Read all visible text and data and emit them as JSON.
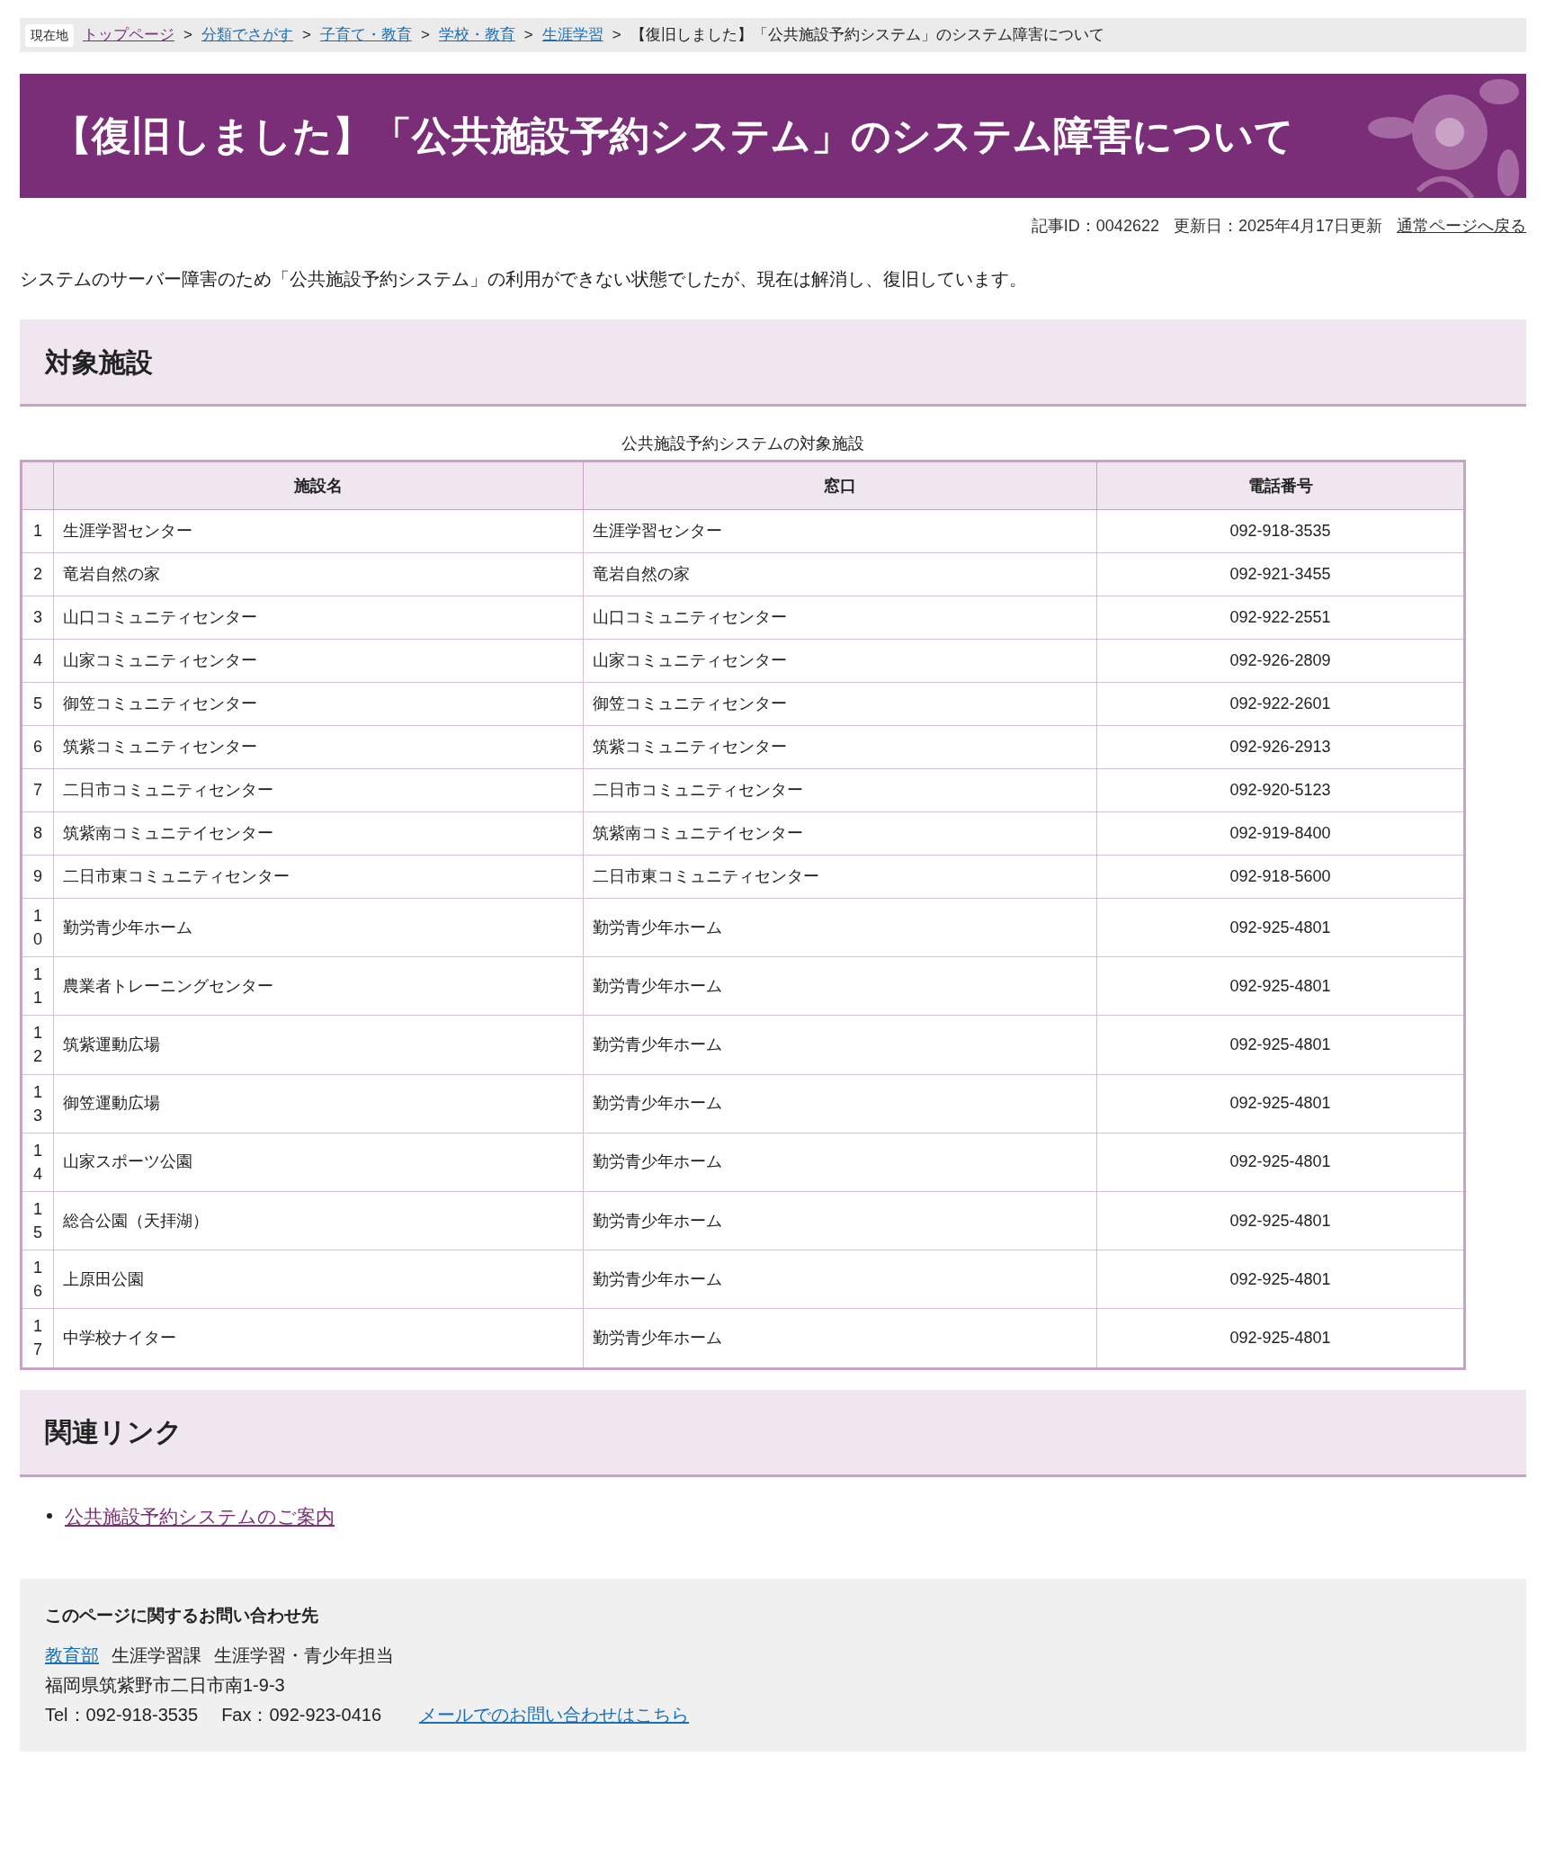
{
  "breadcrumb": {
    "label": "現在地",
    "links": [
      "トップページ",
      "分類でさがす",
      "子育て・教育",
      "学校・教育",
      "生涯学習"
    ],
    "separator": ">",
    "current": "【復旧しました】「公共施設予約システム」のシステム障害について"
  },
  "title": "【復旧しました】「公共施設予約システム」のシステム障害について",
  "meta": {
    "article_id": "記事ID：0042622",
    "updated": "更新日：2025年4月17日更新",
    "back_link": "通常ページへ戻る"
  },
  "intro": "システムのサーバー障害のため「公共施設予約システム」の利用ができない状態でしたが、現在は解消し、復旧しています。",
  "section_facilities": {
    "heading": "対象施設",
    "table": {
      "caption": "公共施設予約システムの対象施設",
      "columns": [
        "施設名",
        "窓口",
        "電話番号"
      ],
      "rows": [
        {
          "no": "1",
          "name": "生涯学習センター",
          "window": "生涯学習センター",
          "phone": "092-918-3535"
        },
        {
          "no": "2",
          "name": "竜岩自然の家",
          "window": "竜岩自然の家",
          "phone": "092-921-3455"
        },
        {
          "no": "3",
          "name": "山口コミュニティセンター",
          "window": "山口コミュニティセンター",
          "phone": "092-922-2551"
        },
        {
          "no": "4",
          "name": "山家コミュニティセンター",
          "window": "山家コミュニティセンター",
          "phone": "092-926-2809"
        },
        {
          "no": "5",
          "name": "御笠コミュニティセンター",
          "window": "御笠コミュニティセンター",
          "phone": "092-922-2601"
        },
        {
          "no": "6",
          "name": "筑紫コミュニティセンター",
          "window": "筑紫コミュニティセンター",
          "phone": "092-926-2913"
        },
        {
          "no": "7",
          "name": "二日市コミュニティセンター",
          "window": "二日市コミュニティセンター",
          "phone": "092-920-5123"
        },
        {
          "no": "8",
          "name": "筑紫南コミュニテイセンター",
          "window": "筑紫南コミュニテイセンター",
          "phone": "092-919-8400"
        },
        {
          "no": "9",
          "name": "二日市東コミュニティセンター",
          "window": "二日市東コミュニティセンター",
          "phone": "092-918-5600"
        },
        {
          "no": "10",
          "name": "勤労青少年ホーム",
          "window": "勤労青少年ホーム",
          "phone": "092-925-4801"
        },
        {
          "no": "11",
          "name": "農業者トレーニングセンター",
          "window": "勤労青少年ホーム",
          "phone": "092-925-4801"
        },
        {
          "no": "12",
          "name": "筑紫運動広場",
          "window": "勤労青少年ホーム",
          "phone": "092-925-4801"
        },
        {
          "no": "13",
          "name": "御笠運動広場",
          "window": "勤労青少年ホーム",
          "phone": "092-925-4801"
        },
        {
          "no": "14",
          "name": "山家スポーツ公園",
          "window": "勤労青少年ホーム",
          "phone": "092-925-4801"
        },
        {
          "no": "15",
          "name": "総合公園（天拝湖）",
          "window": "勤労青少年ホーム",
          "phone": "092-925-4801"
        },
        {
          "no": "16",
          "name": "上原田公園",
          "window": "勤労青少年ホーム",
          "phone": "092-925-4801"
        },
        {
          "no": "17",
          "name": "中学校ナイター",
          "window": "勤労青少年ホーム",
          "phone": "092-925-4801"
        }
      ]
    }
  },
  "section_links": {
    "heading": "関連リンク",
    "links": [
      "公共施設予約システムのご案内"
    ]
  },
  "contact": {
    "heading": "このページに関するお問い合わせ先",
    "department_link": "教育部",
    "section": "生涯学習課",
    "team": "生涯学習・青少年担当",
    "address": "福岡県筑紫野市二日市南1-9-3",
    "tel": "Tel：092-918-3535",
    "fax": "Fax：092-923-0416",
    "mail_link": "メールでのお問い合わせはこちら"
  }
}
